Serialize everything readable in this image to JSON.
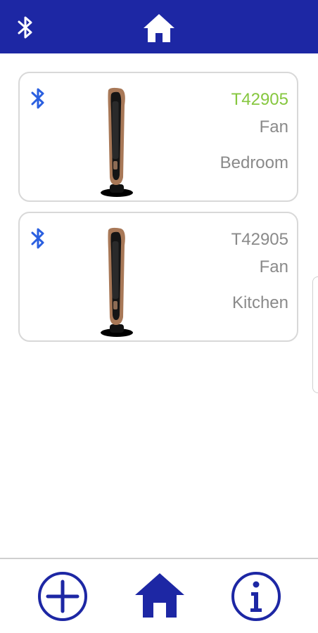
{
  "icons": {
    "header_left": "bluetooth-icon",
    "header_center": "home-icon",
    "card_connection": "bluetooth-icon",
    "bottom_left": "add-icon",
    "bottom_center": "home-icon",
    "bottom_right": "info-icon"
  },
  "colors": {
    "header_background": "#1d27a4",
    "card_bluetooth": "#2a5fe0",
    "active_model_text": "#86c73f",
    "secondary_text": "#8a8a8a",
    "bottom_icon_blue": "#1d27a4"
  },
  "devices": [
    {
      "model": "T42905",
      "type": "Fan",
      "room": "Bedroom",
      "image_icon": "tower-fan-icon"
    },
    {
      "model": "T42905",
      "type": "Fan",
      "room": "Kitchen",
      "image_icon": "tower-fan-icon"
    }
  ]
}
